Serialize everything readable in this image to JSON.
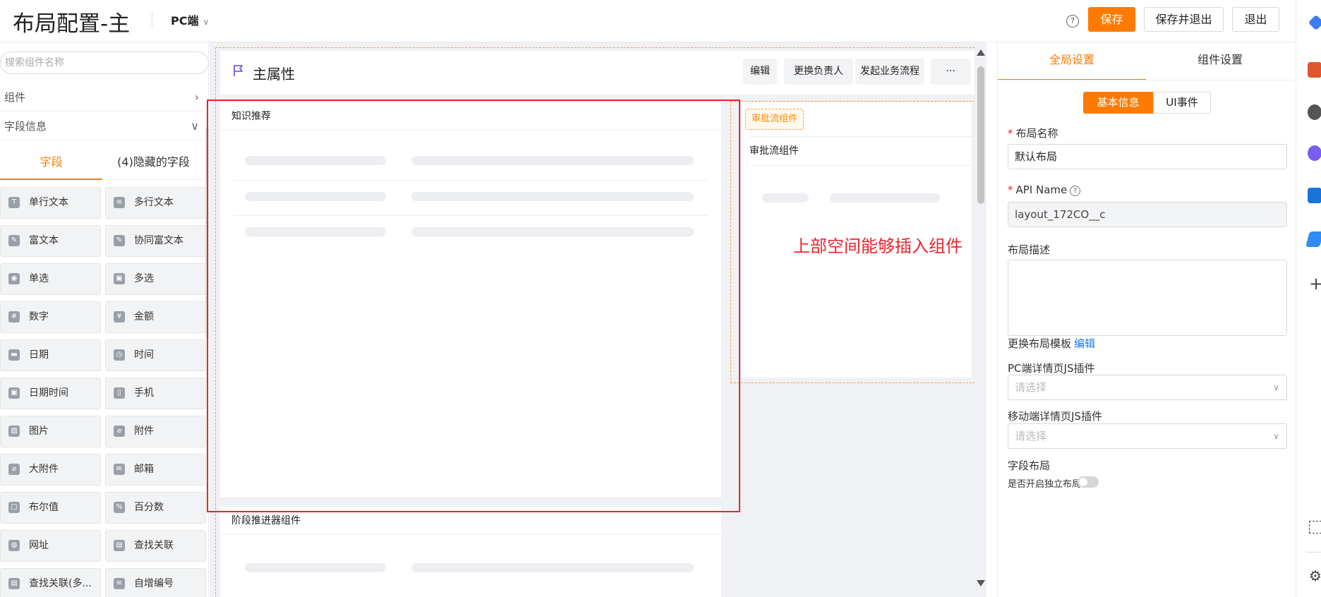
{
  "header": {
    "title": "布局配置-主",
    "platform": "PC端",
    "save_label": "保存",
    "save_exit_label": "保存并退出",
    "exit_label": "退出"
  },
  "left": {
    "search_placeholder": "搜索组件名称",
    "components_label": "组件",
    "fields_label": "字段信息",
    "tab_fields": "字段",
    "tab_hidden": "(4)隐藏的字段",
    "fields": [
      {
        "label": "单行文本",
        "icon": "text-icon"
      },
      {
        "label": "多行文本",
        "icon": "multiline-icon"
      },
      {
        "label": "富文本",
        "icon": "richtext-icon"
      },
      {
        "label": "协同富文本",
        "icon": "collab-richtext-icon"
      },
      {
        "label": "单选",
        "icon": "radio-icon"
      },
      {
        "label": "多选",
        "icon": "checkbox-icon"
      },
      {
        "label": "数字",
        "icon": "hash-icon"
      },
      {
        "label": "金额",
        "icon": "yen-icon"
      },
      {
        "label": "日期",
        "icon": "date-icon"
      },
      {
        "label": "时间",
        "icon": "clock-icon"
      },
      {
        "label": "日期时间",
        "icon": "datetime-icon"
      },
      {
        "label": "手机",
        "icon": "phone-icon"
      },
      {
        "label": "图片",
        "icon": "image-icon"
      },
      {
        "label": "附件",
        "icon": "paperclip-icon"
      },
      {
        "label": "大附件",
        "icon": "large-attachment-icon"
      },
      {
        "label": "邮箱",
        "icon": "mail-icon"
      },
      {
        "label": "布尔值",
        "icon": "boolean-icon"
      },
      {
        "label": "百分数",
        "icon": "percent-icon"
      },
      {
        "label": "网址",
        "icon": "globe-icon"
      },
      {
        "label": "查找关联",
        "icon": "lookup-icon"
      },
      {
        "label": "查找关联(多...",
        "icon": "lookup-multi-icon"
      },
      {
        "label": "自增编号",
        "icon": "autonumber-icon"
      }
    ]
  },
  "canvas": {
    "main_title": "主属性",
    "actions": [
      "编辑",
      "更换负责人",
      "发起业务流程",
      "···"
    ],
    "knowledge_title": "知识推荐",
    "approval_badge": "审批流组件",
    "approval_title": "审批流组件",
    "annotation": "上部空间能够插入组件",
    "stage_title": "阶段推进器组件"
  },
  "right": {
    "tab_global": "全局设置",
    "tab_component": "组件设置",
    "seg_basic": "基本信息",
    "seg_ui": "UI事件",
    "layout_name_label": "布局名称",
    "layout_name_value": "默认布局",
    "api_name_label": "API Name",
    "api_name_value": "layout_172CO__c",
    "desc_label": "布局描述",
    "template_label": "更换布局模板",
    "template_edit": "编辑",
    "pc_plugin_label": "PC端详情页JS插件",
    "pc_plugin_placeholder": "请选择",
    "mobile_plugin_label": "移动端详情页JS插件",
    "mobile_plugin_placeholder": "请选择",
    "field_layout_label": "字段布局",
    "independent_label": "是否开启独立布局"
  },
  "colors": {
    "accent": "#ff7a00",
    "annotation_red": "#e8262b",
    "link": "#1677ff"
  }
}
